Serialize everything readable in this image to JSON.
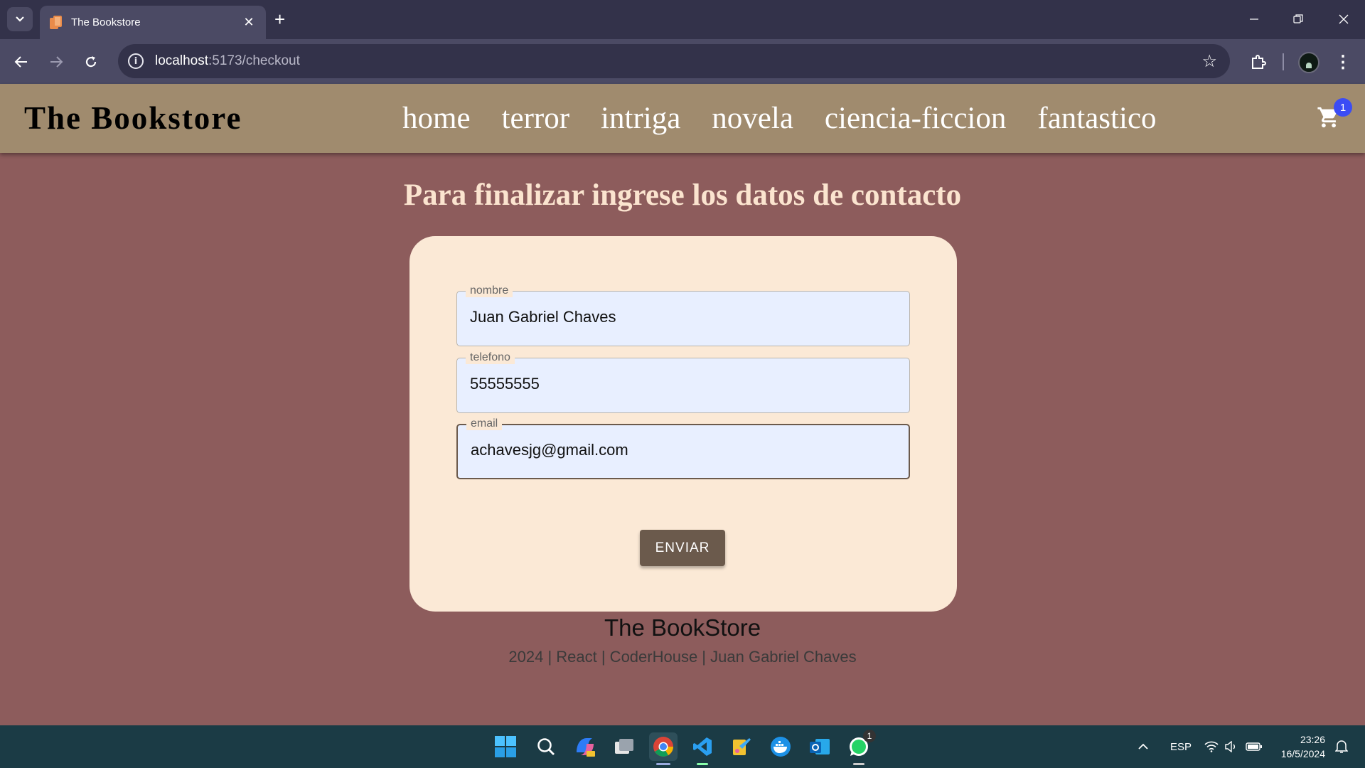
{
  "browser": {
    "tab_title": "The Bookstore",
    "url_host": "localhost",
    "url_path": ":5173/checkout"
  },
  "nav": {
    "brand": "The Bookstore",
    "links": [
      "home",
      "terror",
      "intriga",
      "novela",
      "ciencia-ficcion",
      "fantastico"
    ],
    "cart_count": "1"
  },
  "checkout": {
    "title": "Para finalizar ingrese los datos de contacto",
    "fields": [
      {
        "label": "nombre",
        "value": "Juan Gabriel Chaves"
      },
      {
        "label": "telefono",
        "value": "55555555"
      },
      {
        "label": "email",
        "value": "achavesjg@gmail.com"
      }
    ],
    "submit_label": "ENVIAR"
  },
  "footer": {
    "title": "The BookStore",
    "subtitle": "2024 | React | CoderHouse | Juan Gabriel Chaves"
  },
  "taskbar": {
    "language": "ESP",
    "time": "23:26",
    "date": "16/5/2024",
    "whatsapp_badge": "1",
    "icons": [
      "windows-start-icon",
      "search-icon",
      "copilot-icon",
      "task-view-icon",
      "chrome-icon",
      "vscode-icon",
      "paint-icon",
      "docker-icon",
      "outlook-icon",
      "whatsapp-icon"
    ]
  },
  "colors": {
    "page_bg": "#8d5c5c",
    "nav_bg": "#a08b6e",
    "card_bg": "#fbe9d6",
    "button_bg": "#6b5a4c",
    "title_color": "#fbe4cf",
    "cart_badge": "#3b4cf5"
  }
}
